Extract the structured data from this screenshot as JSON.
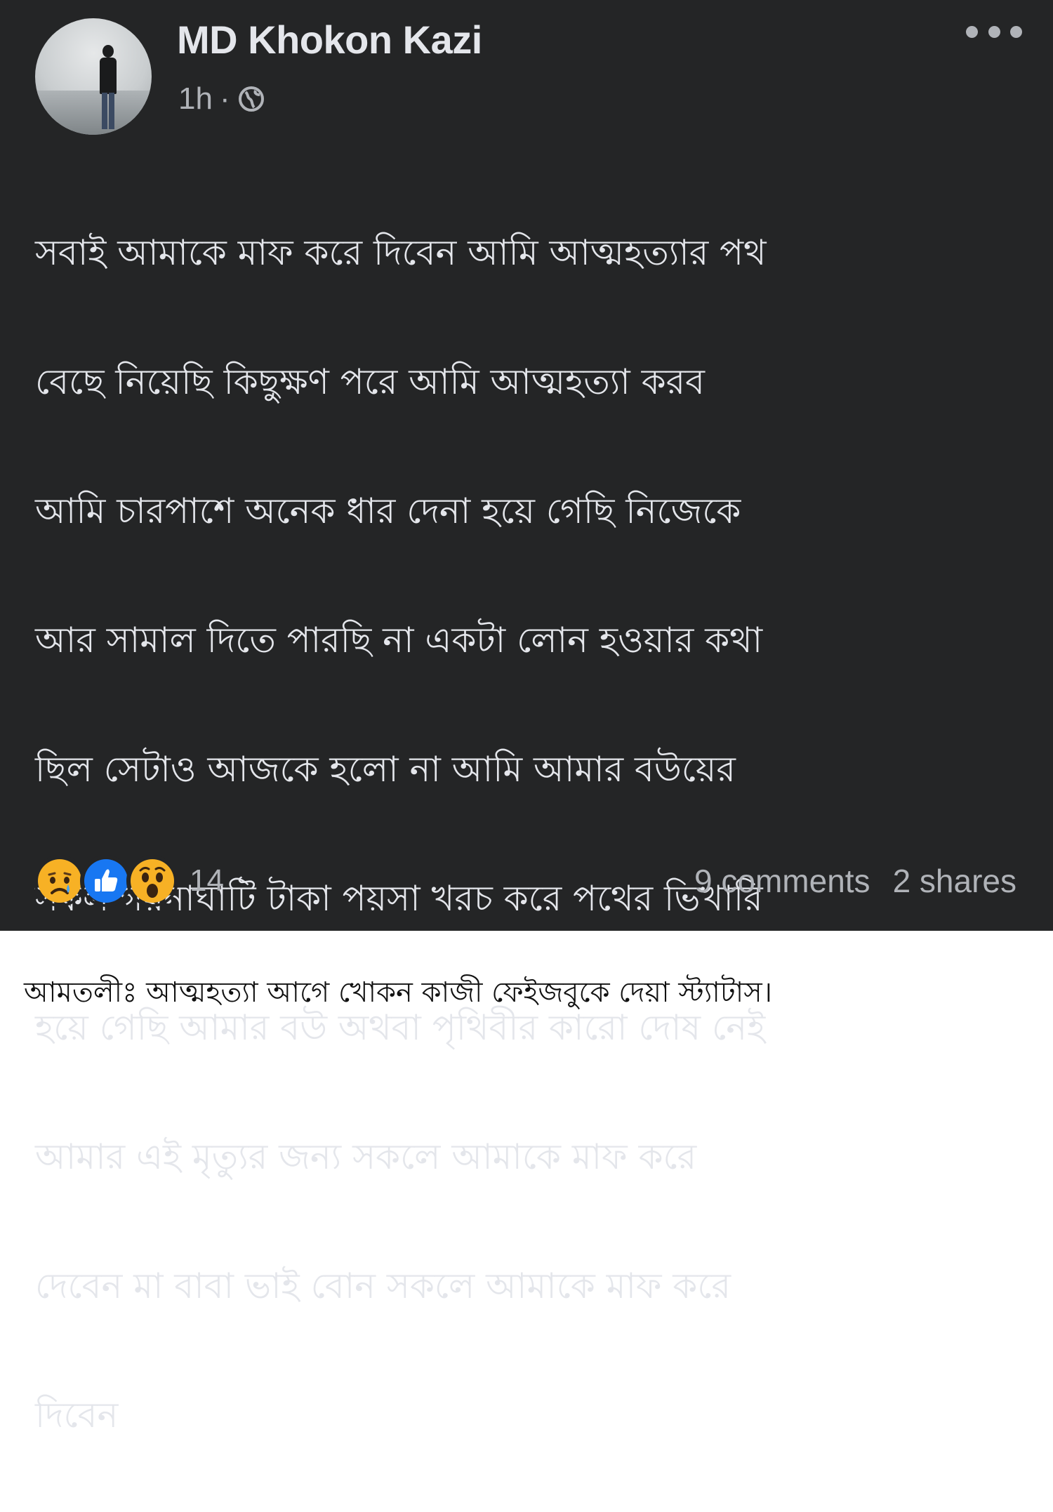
{
  "post": {
    "author": "MD Khokon Kazi",
    "time": "1h",
    "separator": "·",
    "privacy_icon": "globe-icon",
    "menu_icon": "more-options-icon",
    "text_lines": [
      "সবাই আমাকে মাফ করে দিবেন আমি আত্মহত্যার পথ",
      "বেছে নিয়েছি কিছুক্ষণ পরে আমি আত্মহত্যা করব",
      "আমি চারপাশে অনেক ধার দেনা হয়ে গেছি নিজেকে",
      "আর সামাল দিতে পারছি না একটা লোন হওয়ার কথা",
      "ছিল সেটাও আজকে হলো না আমি আমার বউয়ের",
      "সকল গয়নাঘাটি টাকা পয়সা খরচ করে পথের ভিখারি",
      "হয়ে গেছি আমার বউ অথবা পৃথিবীর কারো দোষ নেই",
      "আমার এই মৃত্যুর জন্য সকলে আমাকে মাফ করে",
      "দেবেন মা বাবা ভাই বোন সকলে আমাকে মাফ করে",
      "দিবেন"
    ],
    "reactions": {
      "icons": [
        "sad-reaction-icon",
        "like-reaction-icon",
        "wow-reaction-icon"
      ],
      "count": "14"
    },
    "comments": "9 comments",
    "shares": "2 shares"
  },
  "caption": "আমতলীঃ আত্মহত্যা আগে খোকন কাজী ফেইজবুকে দেয়া স্ট্যাটাস।",
  "colors": {
    "post_background": "#242526",
    "primary_text": "#e4e6eb",
    "secondary_text": "#b0b3b8",
    "like_blue": "#1877f2",
    "reaction_yellow": "#f7b125"
  }
}
